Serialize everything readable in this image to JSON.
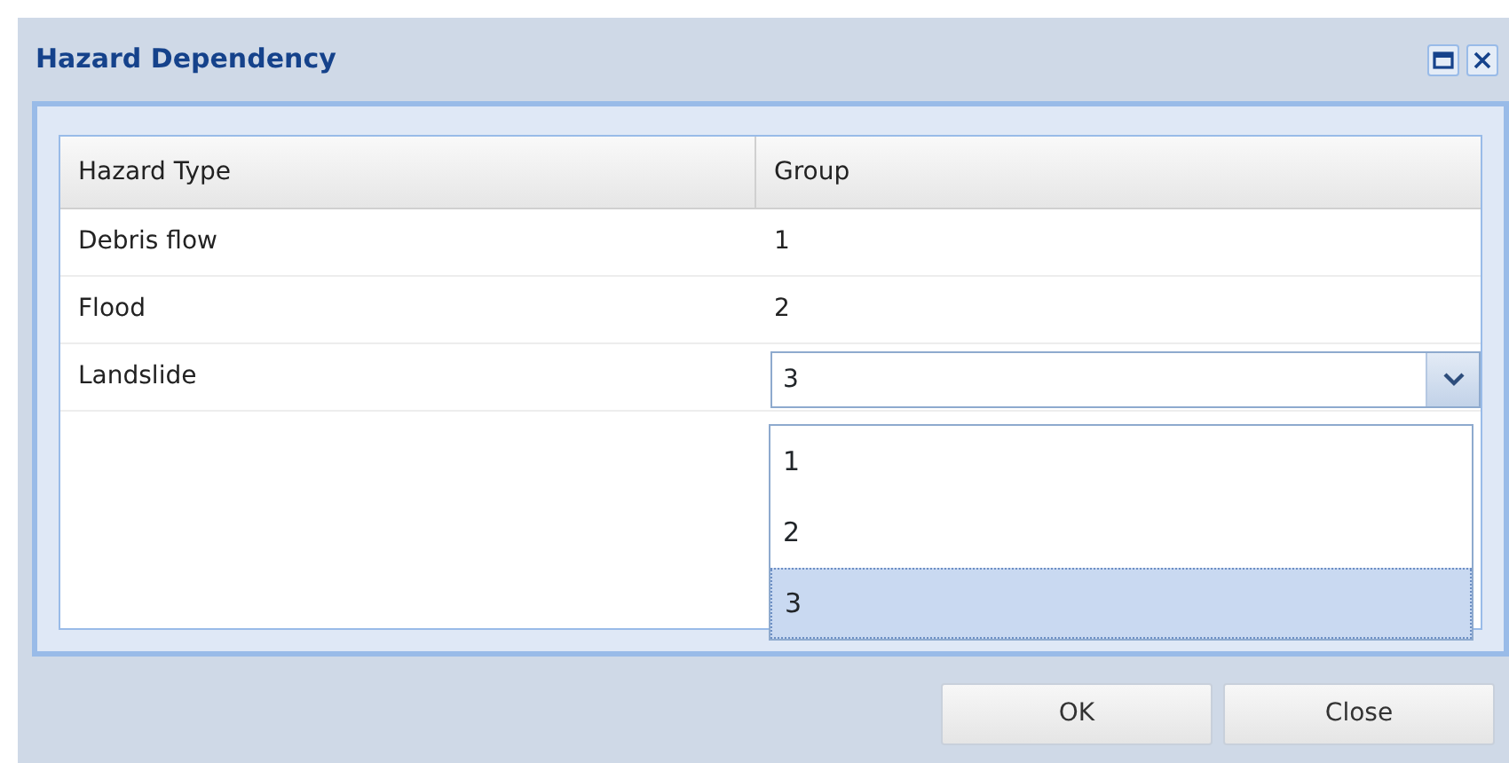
{
  "window": {
    "title": "Hazard Dependency"
  },
  "grid": {
    "columns": [
      "Hazard Type",
      "Group"
    ],
    "rows": [
      {
        "hazard_type": "Debris flow",
        "group": "1",
        "editing": false
      },
      {
        "hazard_type": "Flood",
        "group": "2",
        "editing": false
      },
      {
        "hazard_type": "Landslide",
        "group": "3",
        "editing": true
      }
    ]
  },
  "dropdown": {
    "options": [
      {
        "label": "1",
        "selected": false
      },
      {
        "label": "2",
        "selected": false
      },
      {
        "label": "3",
        "selected": true
      }
    ]
  },
  "buttons": [
    "OK",
    "Close"
  ]
}
